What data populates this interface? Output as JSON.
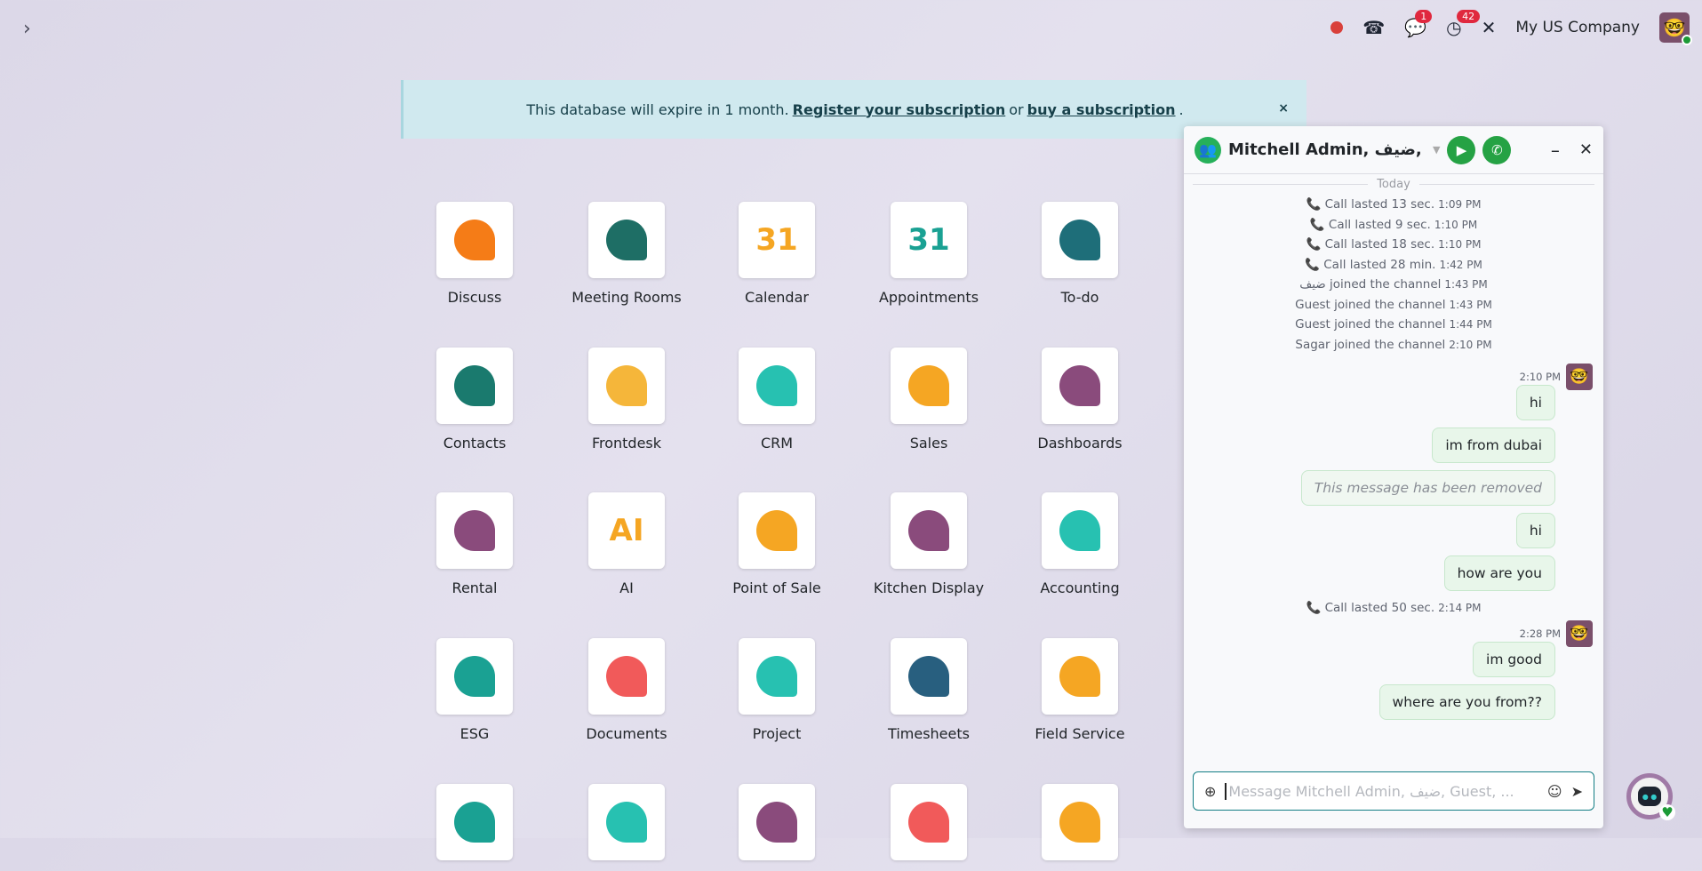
{
  "topbar": {
    "company": "My US Company",
    "messages_badge": "1",
    "activities_badge": "42"
  },
  "banner": {
    "text": "This database will expire in 1 month.",
    "link1": "Register your subscription",
    "or": "or",
    "link2": "buy a subscription",
    "end": ".",
    "close": "×"
  },
  "apps": [
    {
      "label": "Discuss",
      "color": "#f57c17"
    },
    {
      "label": "Meeting Rooms",
      "color": "#1e6e65"
    },
    {
      "label": "Calendar",
      "color": "#f5a623",
      "glyph": "31"
    },
    {
      "label": "Appointments",
      "color": "#1aa193",
      "glyph": "31"
    },
    {
      "label": "To-do",
      "color": "#1e6e79"
    },
    {
      "label": "Contacts",
      "color": "#1a7a6e"
    },
    {
      "label": "Frontdesk",
      "color": "#f5b63a"
    },
    {
      "label": "CRM",
      "color": "#27c1b1"
    },
    {
      "label": "Sales",
      "color": "#f5a623"
    },
    {
      "label": "Dashboards",
      "color": "#8a4b7c"
    },
    {
      "label": "Rental",
      "color": "#8a4b7c"
    },
    {
      "label": "AI",
      "color": "#f5a623",
      "glyph": "AI"
    },
    {
      "label": "Point of Sale",
      "color": "#f5a623"
    },
    {
      "label": "Kitchen Display",
      "color": "#8a4b7c"
    },
    {
      "label": "Accounting",
      "color": "#27c1b1"
    },
    {
      "label": "ESG",
      "color": "#1aa193"
    },
    {
      "label": "Documents",
      "color": "#f15a5a"
    },
    {
      "label": "Project",
      "color": "#27c1b1"
    },
    {
      "label": "Timesheets",
      "color": "#285f7f"
    },
    {
      "label": "Field Service",
      "color": "#f5a623"
    },
    {
      "label": "",
      "color": "#1aa193"
    },
    {
      "label": "",
      "color": "#27c1b1"
    },
    {
      "label": "",
      "color": "#8a4b7c"
    },
    {
      "label": "",
      "color": "#f15a5a"
    },
    {
      "label": "",
      "color": "#f5a623"
    }
  ],
  "chat": {
    "title": "Mitchell Admin, ضيف, G...",
    "divider": "Today",
    "notes": [
      {
        "text": "Call lasted 13 sec.",
        "time": "1:09 PM",
        "call": true
      },
      {
        "text": "Call lasted 9 sec.",
        "time": "1:10 PM",
        "call": true
      },
      {
        "text": "Call lasted 18 sec.",
        "time": "1:10 PM",
        "call": true
      },
      {
        "text": "Call lasted 28 min.",
        "time": "1:42 PM",
        "call": true
      },
      {
        "text": "ضيف joined the channel",
        "time": "1:43 PM"
      },
      {
        "text": "Guest joined the channel",
        "time": "1:43 PM"
      },
      {
        "text": "Guest joined the channel",
        "time": "1:44 PM"
      },
      {
        "text": "Sagar joined the channel",
        "time": "2:10 PM"
      }
    ],
    "group1_time": "2:10 PM",
    "group1": [
      "hi",
      "im from dubai",
      "This message has been removed",
      "hi",
      "how are you"
    ],
    "call_note": {
      "text": "Call lasted 50 sec.",
      "time": "2:14 PM"
    },
    "group2_time": "2:28 PM",
    "group2": [
      "im good",
      "where are you from??"
    ],
    "placeholder": "Message Mitchell Admin, ضيف, Guest, ..."
  }
}
